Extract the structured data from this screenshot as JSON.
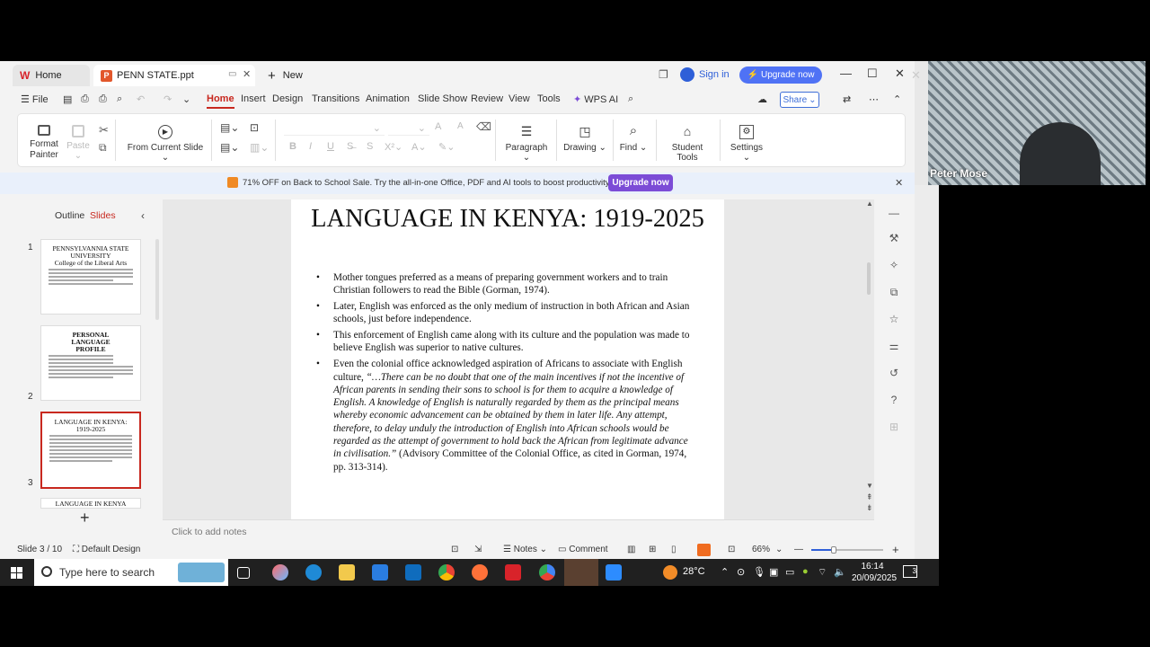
{
  "titlebar": {
    "home_tab": "Home",
    "file_tab": "PENN STATE.ppt",
    "new_tab": "New",
    "sign_in": "Sign in",
    "upgrade": "Upgrade now"
  },
  "menu": {
    "file": "File",
    "items": [
      "Home",
      "Insert",
      "Design",
      "Transitions",
      "Animation",
      "Slide Show",
      "Review",
      "View",
      "Tools"
    ],
    "wps_ai": "WPS AI",
    "share": "Share"
  },
  "ribbon": {
    "format_painter": "Format\nPainter",
    "paste": "Paste",
    "from_current_slide": "From Current Slide",
    "paragraph": "Paragraph",
    "drawing": "Drawing",
    "find": "Find",
    "student_tools": "Student Tools",
    "settings": "Settings"
  },
  "promo": {
    "text": "71% OFF on Back to School Sale. Try the all-in-one Office, PDF and AI tools to boost productivity.",
    "button": "Upgrade now"
  },
  "left_panel": {
    "tab_outline": "Outline",
    "tab_slides": "Slides",
    "thumbs": [
      {
        "num": "1",
        "title": "PENNSYLVANNIA STATE UNIVERSITY\nCollege of the Liberal Arts"
      },
      {
        "num": "2",
        "title": "PERSONAL LANGUAGE PROFILE"
      },
      {
        "num": "3",
        "title": "LANGUAGE IN KENYA: 1919-2025"
      },
      {
        "num": "4",
        "title": "LANGUAGE IN KENYA"
      }
    ]
  },
  "slide": {
    "title": "LANGUAGE IN KENYA: 1919-2025",
    "bullets": [
      "Mother tongues preferred as a means of preparing government workers and to train Christian followers to read the Bible (Gorman, 1974).",
      "Later, English was enforced as the only medium of instruction in both African and Asian schools, just before independence.",
      "This enforcement of English came along with its culture and the population was made to believe English was superior to native cultures."
    ],
    "bullet4_pre": "Even the colonial office acknowledged aspiration of Africans to associate with English culture, ",
    "bullet4_quote": "“…There can be no doubt that one of the main incentives if not the incentive of African parents in sending their sons to school is for them to acquire a knowledge of English. A knowledge of English is naturally regarded by them as the principal means whereby economic advancement can be obtained by them in later life. Any attempt, therefore, to delay unduly the introduction of English into African schools would be regarded as the attempt of government to hold back the African from legitimate advance in civilisation.”",
    "bullet4_post": " (Advisory Committee of the Colonial Office, as cited in Gorman, 1974, pp. 313-314)."
  },
  "notes_placeholder": "Click to add notes",
  "status": {
    "slide_counter": "Slide 3 / 10",
    "design": "Default Design",
    "notes": "Notes",
    "comment": "Comment",
    "zoom": "66%"
  },
  "webcam": {
    "name": "Peter Mose"
  },
  "taskbar": {
    "search_placeholder": "Type here to search",
    "temperature": "28°C",
    "time": "16:14",
    "date": "20/09/2025",
    "notifications": "3"
  },
  "colors": {
    "accent": "#c8281f",
    "upgrade_blue": "#4f72f5",
    "promo_purple": "#7c4cd6"
  }
}
